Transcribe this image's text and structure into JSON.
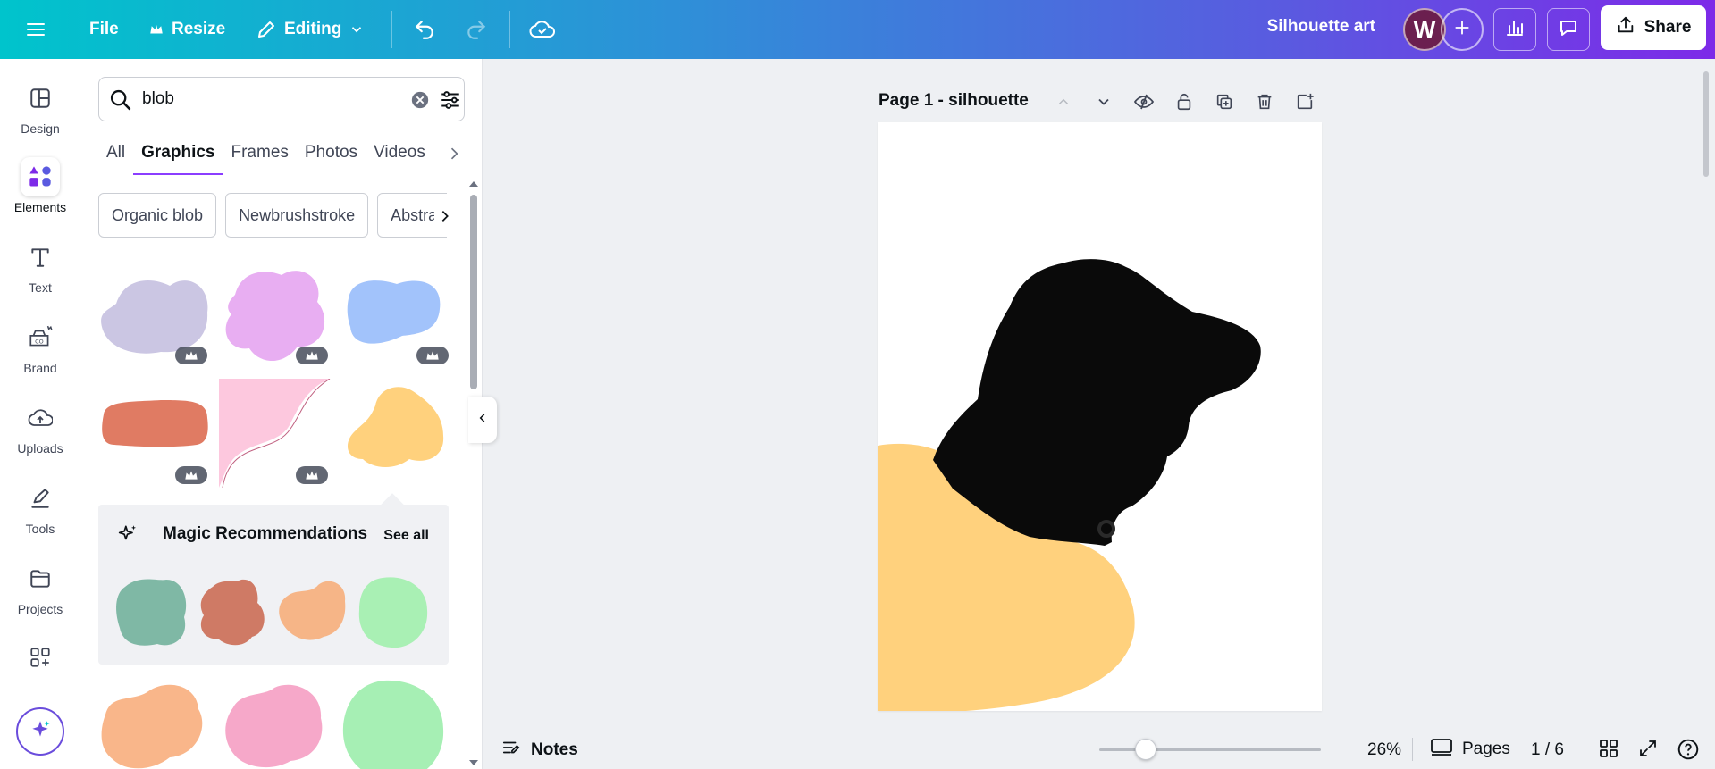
{
  "topbar": {
    "file_label": "File",
    "resize_label": "Resize",
    "editing_label": "Editing",
    "design_title": "Silhouette art",
    "avatar_initial": "W",
    "share_label": "Share",
    "gradient_colors": [
      "#00c4cc",
      "#7d2ae8"
    ]
  },
  "rail": {
    "items": [
      {
        "label": "Design",
        "icon": "layout-icon"
      },
      {
        "label": "Elements",
        "icon": "shapes-icon"
      },
      {
        "label": "Text",
        "icon": "text-icon"
      },
      {
        "label": "Brand",
        "icon": "brand-icon"
      },
      {
        "label": "Uploads",
        "icon": "cloud-upload-icon"
      },
      {
        "label": "Tools",
        "icon": "pen-icon"
      },
      {
        "label": "Projects",
        "icon": "folder-icon"
      }
    ],
    "active": "Elements"
  },
  "panel": {
    "search_value": "blob",
    "tabs": [
      "All",
      "Graphics",
      "Frames",
      "Photos",
      "Videos"
    ],
    "active_tab": "Graphics",
    "chips": [
      "Organic blob",
      "Newbrushstroke",
      "Abstract"
    ],
    "graphics_colors": [
      "#cbc6e3",
      "#e8aef2",
      "#a2c3fb",
      "#e07b63",
      "#fdc8de",
      "#ffd17d"
    ],
    "magic": {
      "title": "Magic Recommendations",
      "see_all": "See all",
      "colors": [
        "#7fb8a5",
        "#cf7a65",
        "#f6b587",
        "#a9f0b4"
      ]
    },
    "more_colors": [
      "#f9b68a",
      "#f6a8c9",
      "#a6efb4"
    ]
  },
  "canvas": {
    "page_label": "Page 1 - silhouette",
    "blob_color": "#ffd17d",
    "silhouette_color": "#0a0a0a"
  },
  "bottombar": {
    "notes_label": "Notes",
    "zoom": "26%",
    "zoom_fraction": 0.21,
    "pages_label": "Pages",
    "page_count": "1 / 6"
  }
}
